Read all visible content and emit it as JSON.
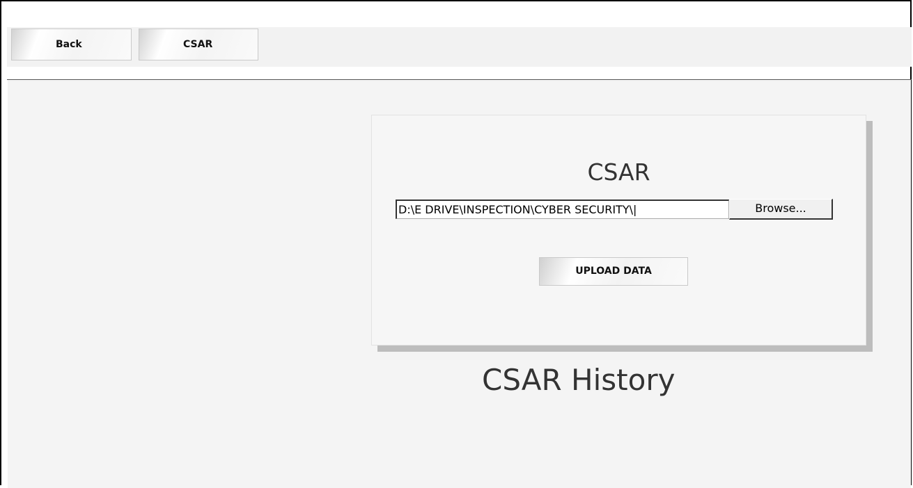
{
  "toolbar": {
    "back_label": "Back",
    "csar_label": "CSAR"
  },
  "upload_card": {
    "title": "CSAR",
    "file_path_value": "D:\\E DRIVE\\INSPECTION\\CYBER SECURITY\\|",
    "browse_label": "Browse...",
    "upload_label": "UPLOAD DATA"
  },
  "history": {
    "title": "CSAR History"
  }
}
